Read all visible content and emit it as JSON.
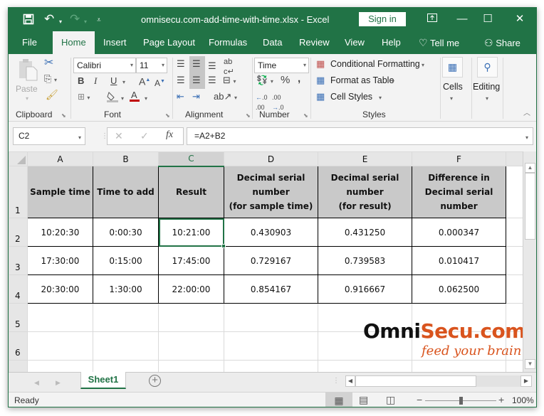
{
  "window": {
    "title": "omnisecu.com-add-time-with-time.xlsx  -  Excel",
    "sign_in_label": "Sign in",
    "accent_color": "#217346"
  },
  "qat": {
    "save_icon": "save-icon",
    "undo_icon": "undo-icon",
    "redo_icon": "redo-icon",
    "customize_icon": "customize-qat-icon"
  },
  "window_controls": {
    "ribbon_display_icon": "ribbon-display-options-icon",
    "minimize_icon": "minimize-icon",
    "maximize_icon": "maximize-icon",
    "close_icon": "close-icon"
  },
  "tabs": [
    {
      "label": "File"
    },
    {
      "label": "Home",
      "active": true
    },
    {
      "label": "Insert"
    },
    {
      "label": "Page Layout"
    },
    {
      "label": "Formulas"
    },
    {
      "label": "Data"
    },
    {
      "label": "Review"
    },
    {
      "label": "View"
    },
    {
      "label": "Help"
    },
    {
      "label": "Tell me"
    },
    {
      "label": "Share"
    }
  ],
  "ribbon": {
    "clipboard": {
      "label": "Clipboard",
      "paste_label": "Paste"
    },
    "font": {
      "label": "Font",
      "font_name": "Calibri",
      "font_size": "11",
      "bold": "B",
      "italic": "I",
      "underline": "U",
      "font_color": "#c00000"
    },
    "alignment": {
      "label": "Alignment"
    },
    "number": {
      "label": "Number",
      "format": "Time",
      "percent": "%",
      "comma": ",",
      "inc_decimal": "←.0 .00",
      "dec_decimal": ".00 →.0"
    },
    "styles": {
      "label": "Styles",
      "conditional_formatting": "Conditional Formatting",
      "format_as_table": "Format as Table",
      "cell_styles": "Cell Styles"
    },
    "cells": {
      "label": "Cells"
    },
    "editing": {
      "label": "Editing"
    }
  },
  "formula_bar": {
    "name_box": "C2",
    "fx_label": "fx",
    "formula": "=A2+B2"
  },
  "sheet": {
    "columns": [
      "A",
      "B",
      "C",
      "D",
      "E",
      "F"
    ],
    "selected_column": "C",
    "rows": [
      "1",
      "2",
      "3",
      "4",
      "5",
      "6"
    ],
    "headers": [
      "Sample time",
      "Time to add",
      "Result",
      "Decimal serial number (for sample time)",
      "Decimal serial number (for result)",
      "Difference in Decimal serial number"
    ],
    "header_lines": {
      "D": [
        "Decimal serial",
        "number",
        "(for sample time)"
      ],
      "E": [
        "Decimal serial",
        "number",
        "(for result)"
      ],
      "F": [
        "Difference in",
        "Decimal serial",
        "number"
      ]
    },
    "data": [
      [
        "10:20:30",
        "0:00:30",
        "10:21:00",
        "0.430903",
        "0.431250",
        "0.000347"
      ],
      [
        "17:30:00",
        "0:15:00",
        "17:45:00",
        "0.729167",
        "0.739583",
        "0.010417"
      ],
      [
        "20:30:00",
        "1:30:00",
        "22:00:00",
        "0.854167",
        "0.916667",
        "0.062500"
      ]
    ],
    "selected_cell": "C2"
  },
  "watermark": {
    "omni": "Omni",
    "secu": "Secu.com",
    "tagline": "feed your brain",
    "omni_color": "#111111",
    "secu_color": "#d9541e"
  },
  "sheet_tabs": [
    {
      "label": "Sheet1",
      "active": true
    }
  ],
  "status": {
    "ready": "Ready",
    "zoom": "100%",
    "zoom_level": 100
  }
}
